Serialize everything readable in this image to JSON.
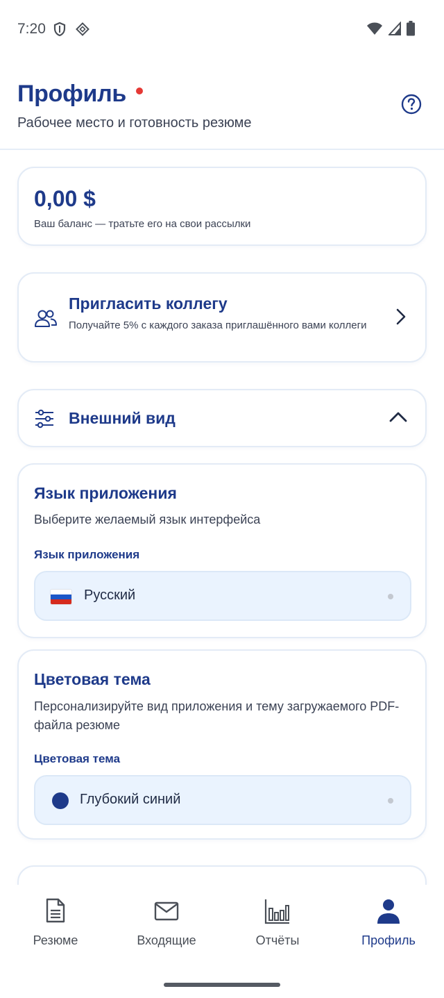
{
  "status_bar": {
    "time": "7:20",
    "left_icons": [
      "shield-icon",
      "vpn-icon"
    ],
    "right_icons": [
      "wifi-icon",
      "signal-icon",
      "battery-icon"
    ]
  },
  "header": {
    "title": "Профиль",
    "subtitle": "Рабочее место и готовность резюме",
    "help_icon": "help-icon"
  },
  "balance": {
    "amount": "0,00 $",
    "caption": "Ваш баланс — тратьте его на свои рассылки"
  },
  "invite": {
    "icon": "people-icon",
    "title": "Пригласить коллегу",
    "description": "Получайте 5% с каждого заказа приглашённого вами коллеги"
  },
  "appearance": {
    "icon": "sliders-icon",
    "title": "Внешний вид",
    "expanded": true
  },
  "language": {
    "title": "Язык приложения",
    "description": "Выберите желаемый язык интерфейса",
    "field_label": "Язык приложения",
    "selected": "Русский",
    "flag": "russia-flag"
  },
  "theme": {
    "title": "Цветовая тема",
    "description": "Персонализируйте вид приложения и тему загружаемого PDF-файла резюме",
    "field_label": "Цветовая тема",
    "selected": "Глубокий синий",
    "swatch_color": "#1e3a8a"
  },
  "bottom_nav": {
    "items": [
      {
        "label": "Резюме",
        "icon": "document-icon",
        "active": false
      },
      {
        "label": "Входящие",
        "icon": "mail-icon",
        "active": false
      },
      {
        "label": "Отчёты",
        "icon": "bar-chart-icon",
        "active": false
      },
      {
        "label": "Профиль",
        "icon": "person-icon",
        "active": true
      }
    ]
  },
  "colors": {
    "primary": "#1e3a8a",
    "accent_dot": "#e53935",
    "field_background": "#eaf3fe",
    "card_border": "#e3ebf6"
  }
}
